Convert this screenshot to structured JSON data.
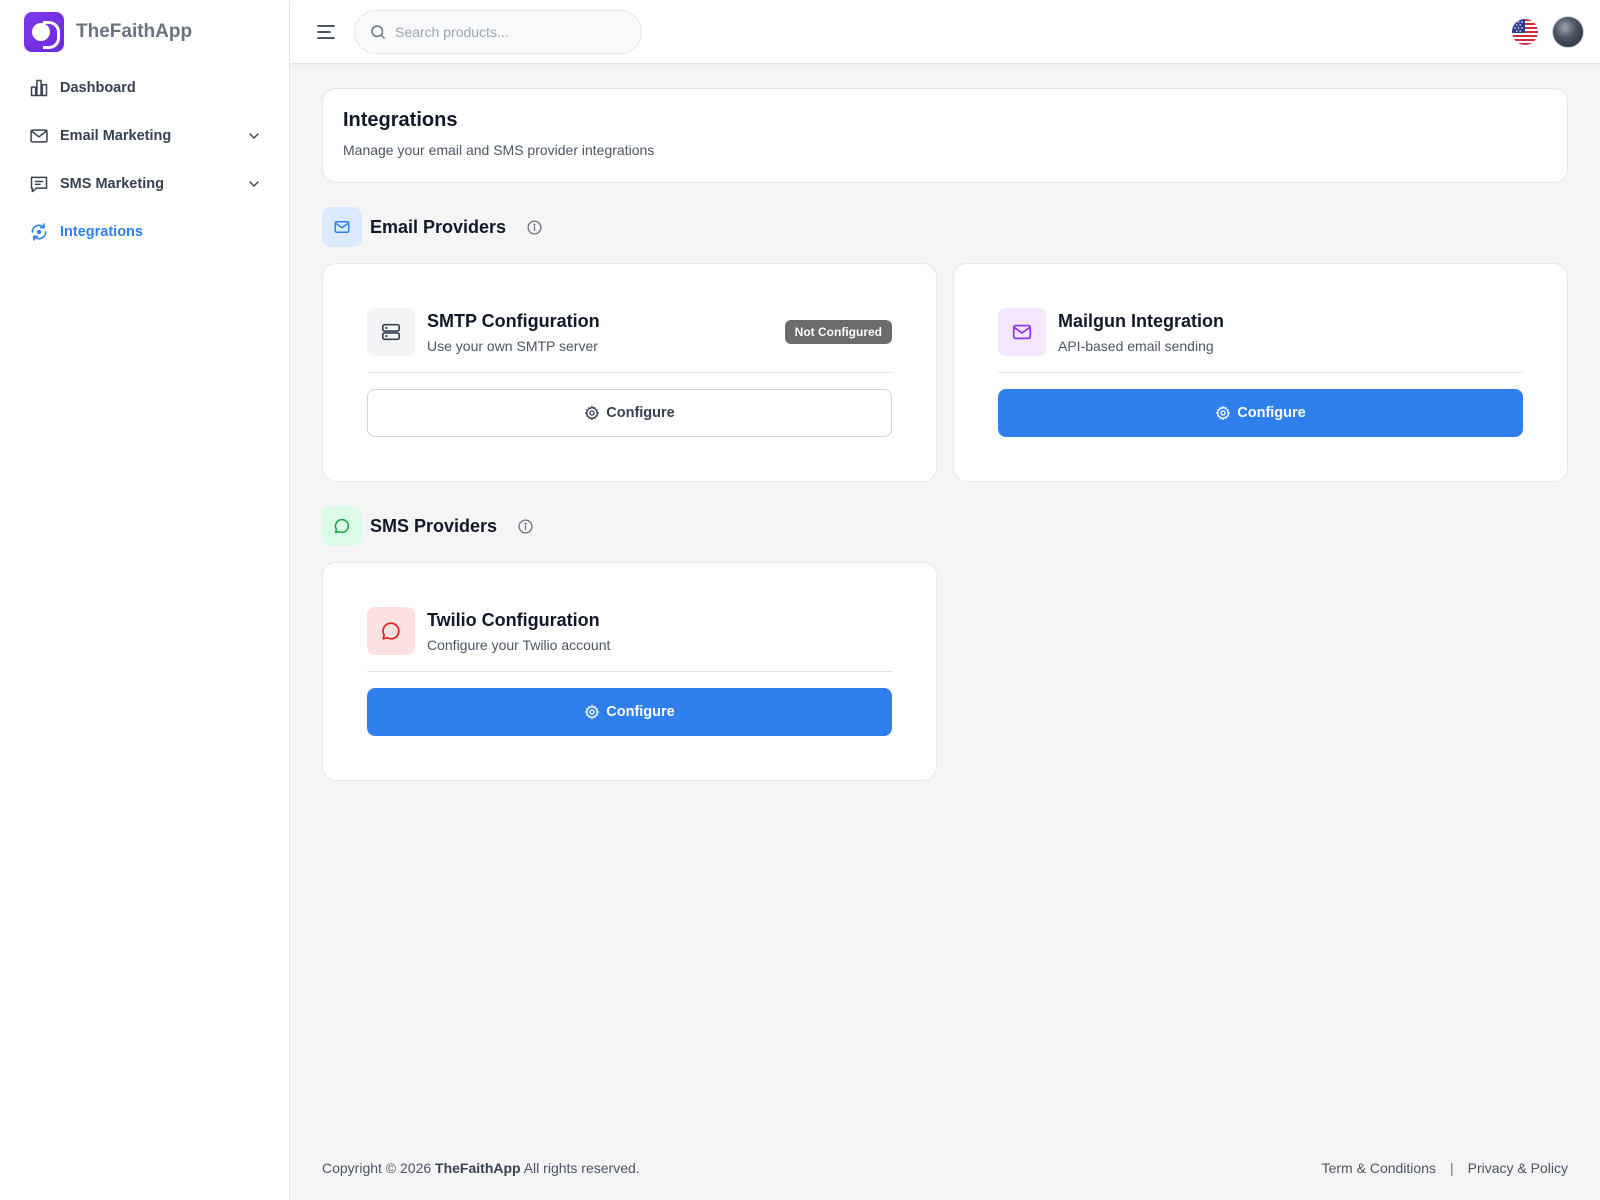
{
  "brand": {
    "name": "TheFaithApp"
  },
  "sidebar": {
    "items": [
      {
        "label": "Dashboard",
        "icon": "bar-chart-icon"
      },
      {
        "label": "Email Marketing",
        "icon": "mail-icon",
        "expandable": true
      },
      {
        "label": "SMS Marketing",
        "icon": "message-square-icon",
        "expandable": true
      },
      {
        "label": "Integrations",
        "icon": "refresh-icon",
        "active": true
      }
    ]
  },
  "header": {
    "search_placeholder": "Search products...",
    "language_icon": "us-flag-icon",
    "avatar_icon": "user-avatar"
  },
  "page": {
    "title": "Integrations",
    "subtitle": "Manage your email and SMS provider integrations"
  },
  "email_section": {
    "title": "Email Providers",
    "cards": [
      {
        "title": "SMTP Configuration",
        "desc": "Use your own SMTP server",
        "badge": "Not Configured",
        "button": "Configure",
        "style": "outline",
        "icon": "server-icon"
      },
      {
        "title": "Mailgun Integration",
        "desc": "API-based email sending",
        "badge": "",
        "button": "Configure",
        "style": "primary",
        "icon": "mail-icon"
      }
    ]
  },
  "sms_section": {
    "title": "SMS Providers",
    "cards": [
      {
        "title": "Twilio Configuration",
        "desc": "Configure your Twilio account",
        "badge": "",
        "button": "Configure",
        "style": "primary",
        "icon": "message-circle-icon"
      }
    ]
  },
  "footer": {
    "copyright_prefix": "Copyright © 2026",
    "brand": "TheFaithApp",
    "copyright_suffix": "All rights reserved.",
    "terms": "Term & Conditions",
    "separator": "|",
    "privacy": "Privacy & Policy"
  },
  "colors": {
    "accent": "#2f80ed",
    "brand": "#7c3aed",
    "badge": "#6b6b6b"
  }
}
